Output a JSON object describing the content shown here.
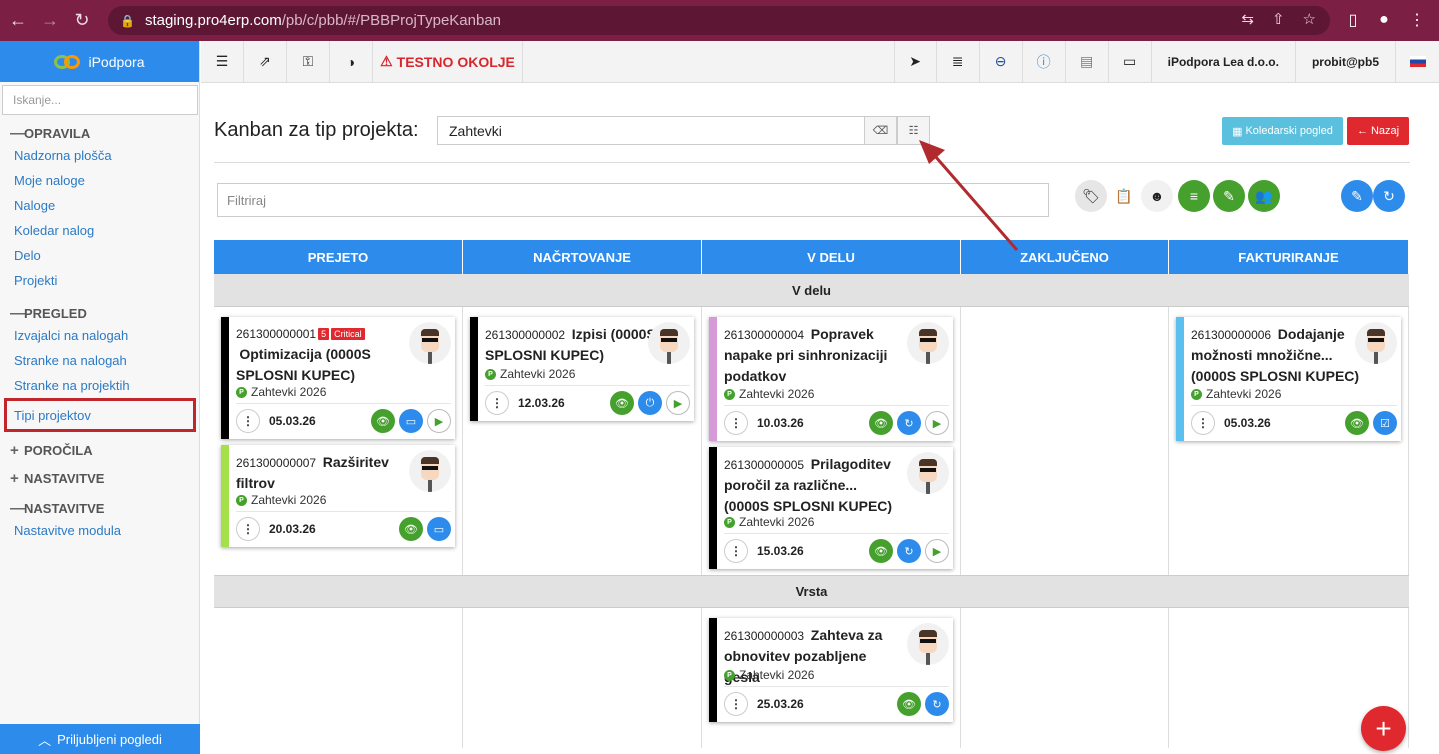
{
  "browser": {
    "url_host": "staging.pro4erp.com",
    "url_path": "/pb/c/pbb/#/PBBProjTypeKanban"
  },
  "sidebar": {
    "brand": "iPodpora",
    "search_placeholder": "Iskanje...",
    "sections": [
      {
        "sign": "—",
        "title": "OPRAVILA",
        "items": [
          "Nadzorna plošča",
          "Moje naloge",
          "Naloge",
          "Koledar nalog",
          "Delo",
          "Projekti"
        ]
      },
      {
        "sign": "—",
        "title": "PREGLED",
        "items": [
          "Izvajalci na nalogah",
          "Stranke na nalogah",
          "Stranke na projektih",
          "Tipi projektov"
        ]
      },
      {
        "sign": "+",
        "title": "POROČILA",
        "items": []
      },
      {
        "sign": "+",
        "title": "NASTAVITVE",
        "items": []
      },
      {
        "sign": "—",
        "title": "NASTAVITVE",
        "items": [
          "Nastavitve modula"
        ]
      }
    ],
    "favorites": "Priljubljeni pogledi"
  },
  "topbar": {
    "warning": "TESTNO OKOLJE",
    "company": "iPodpora Lea d.o.o.",
    "user": "probit@pb5"
  },
  "page": {
    "title": "Kanban za tip projekta:",
    "selected_type": "Zahtevki",
    "calendar_button": "Koledarski pogled",
    "back_button": "Nazaj",
    "filter_placeholder": "Filtriraj"
  },
  "board": {
    "columns": [
      "PREJETO",
      "NAČRTOVANJE",
      "V DELU",
      "ZAKLJUČENO",
      "FAKTURIRANJE"
    ],
    "lanes": [
      "V delu",
      "Vrsta"
    ],
    "cards": [
      {
        "num": "261300000001",
        "badge_count": "5",
        "badge_label": "Critical",
        "title": "Optimizacija (0000S SPLOSNI KUPEC)",
        "project": "Zahtevki 2026",
        "date": "05.03.26",
        "color": "#000000"
      },
      {
        "num": "261300000007",
        "title": "Razširitev filtrov",
        "project": "Zahtevki 2026",
        "date": "20.03.26",
        "color": "#a4e04a"
      },
      {
        "num": "261300000002",
        "title": "Izpisi (0000S SPLOSNI KUPEC)",
        "project": "Zahtevki 2026",
        "date": "12.03.26",
        "color": "#000000"
      },
      {
        "num": "261300000004",
        "title": "Popravek napake pri sinhronizaciji podatkov",
        "project": "Zahtevki 2026",
        "date": "10.03.26",
        "color": "#d79ad9"
      },
      {
        "num": "261300000005",
        "title": "Prilagoditev poročil za različne... (0000S SPLOSNI KUPEC)",
        "project": "Zahtevki 2026",
        "date": "15.03.26",
        "color": "#000000"
      },
      {
        "num": "261300000006",
        "title": "Dodajanje možnosti množične... (0000S SPLOSNI KUPEC)",
        "project": "Zahtevki 2026",
        "date": "05.03.26",
        "color": "#5bc0f0"
      },
      {
        "num": "261300000003",
        "title": "Zahteva za obnovitev pozabljene gesla",
        "project": "Zahtevki 2026",
        "date": "25.03.26",
        "color": "#000000"
      }
    ]
  },
  "colors": {
    "accent": "#2d8ceb",
    "danger": "#e0292e",
    "browser": "#7b1f45",
    "highlight": "#c0272d"
  }
}
